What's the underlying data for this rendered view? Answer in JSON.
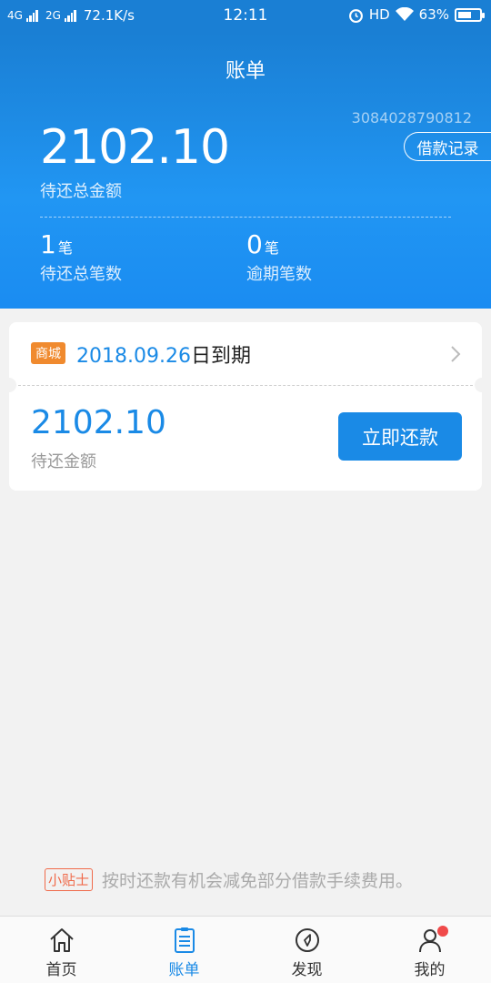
{
  "status_bar": {
    "net1": "4G",
    "net2": "2G",
    "speed": "72.1K/s",
    "time": "12:11",
    "hd": "HD",
    "battery": "63%",
    "battery_level": 0.63
  },
  "header": {
    "title": "账单",
    "phone": "3084028790812",
    "loan_record": "借款记录",
    "total_amount": "2102.10",
    "total_label": "待还总金额",
    "count_value": "1",
    "count_unit": "笔",
    "count_label": "待还总笔数",
    "overdue_value": "0",
    "overdue_unit": "笔",
    "overdue_label": "逾期笔数"
  },
  "bill_card": {
    "tag": "商城",
    "due_date": "2018.09.26",
    "due_suffix": "日到期",
    "amount": "2102.10",
    "amount_label": "待还金额",
    "pay_button": "立即还款"
  },
  "tips": {
    "badge": "小贴士",
    "text": "按时还款有机会减免部分借款手续费用。"
  },
  "tabs": [
    {
      "label": "首页",
      "icon": "home-icon"
    },
    {
      "label": "账单",
      "icon": "bill-icon"
    },
    {
      "label": "发现",
      "icon": "compass-icon"
    },
    {
      "label": "我的",
      "icon": "user-icon"
    }
  ],
  "colors": {
    "primary": "#1a8ae6",
    "tag_orange": "#f08a2e",
    "tip_red": "#f06a4a",
    "notification": "#f04a4a"
  }
}
